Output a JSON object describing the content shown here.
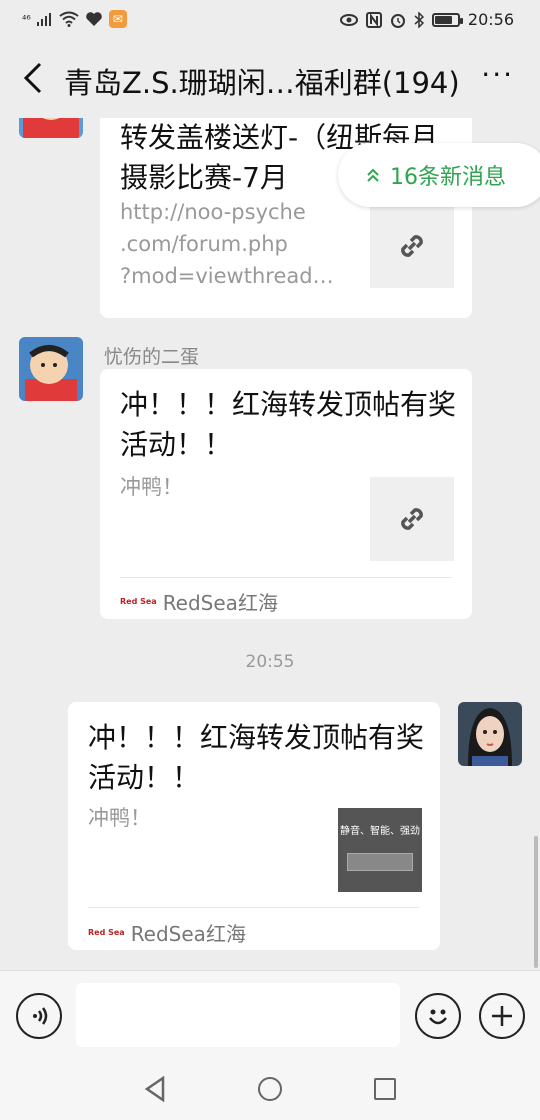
{
  "status": {
    "signal": "⁴⁶",
    "time": "20:56",
    "battery_level": 0.8
  },
  "header": {
    "title": "青岛Z.S.珊瑚闲…福利群(194)",
    "more": "···"
  },
  "new_messages": {
    "label": "16条新消息"
  },
  "messages": [
    {
      "title": "转发盖楼送灯-（纽斯每月摄影比赛-7月",
      "desc": "http://noo-psyche\n.com/forum.php\n?mod=viewthread…"
    },
    {
      "sender": "忧伤的二蛋",
      "title": "冲！！！红海转发顶帖有奖活动！！",
      "desc": "冲鸭！",
      "source": "RedSea红海",
      "source_logo": "Red Sea"
    },
    {
      "timestamp": "20:55"
    },
    {
      "title": "冲！！！红海转发顶帖有奖活动！！",
      "desc": "冲鸭！",
      "source": "RedSea红海",
      "source_logo": "Red Sea",
      "thumb_text": "静音、智能、强劲"
    }
  ],
  "input": {
    "placeholder": ""
  },
  "colors": {
    "accent": "#2ea44f",
    "background": "#ededed"
  }
}
